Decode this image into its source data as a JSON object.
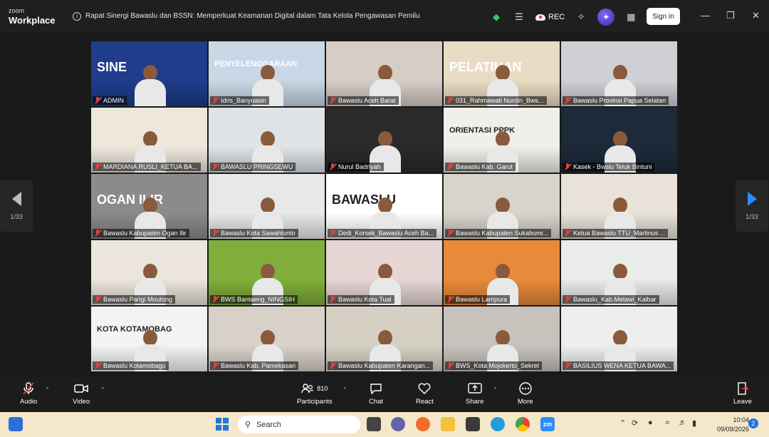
{
  "app": {
    "brand_top": "zoom",
    "brand_name": "Workplace"
  },
  "meeting": {
    "title": "Rapat Sinergi Bawaslu dan BSSN: Memperkuat Keamanan Digital dalam Tata Kelola Pengawasan Pemilu"
  },
  "titlebar": {
    "rec_label": "REC",
    "signin_label": "Sign in"
  },
  "pager": {
    "left_label": "1/33",
    "right_label": "1/33"
  },
  "participants": [
    {
      "name": "ADMIN",
      "bg": "#1f3d8a",
      "active": true,
      "overlay": "SINE"
    },
    {
      "name": "Idris_Banyuasin",
      "bg": "#c9d8e6",
      "overlay": "PENYELENGGARAAN"
    },
    {
      "name": "Bawaslu Aceh Barat",
      "bg": "#d6cdc6"
    },
    {
      "name": "031_Rahmawati Nurdin_Bws...",
      "bg": "#e9dcc4",
      "overlay": "PELATIHAN"
    },
    {
      "name": "Bawaslu Provinsi Papua Selatan",
      "bg": "#cfd0d6"
    },
    {
      "name": "MARDIANA RUSLI_KETUA BA...",
      "bg": "#eee7dc"
    },
    {
      "name": "BAWASLU PRINGSEWU",
      "bg": "#dfe3e6"
    },
    {
      "name": "Nurul Badriyah",
      "bg": "#2a2a2a"
    },
    {
      "name": "Bawaslu Kab. Garut",
      "bg": "#f1efe9",
      "overlay": "ORIENTASI PPPK"
    },
    {
      "name": "Kasek - Bwslu Teluk Bintuni",
      "bg": "#1d2a3a"
    },
    {
      "name": "Bawaslu Kabupaten Ogan Ilir",
      "bg": "#8b8b8b",
      "overlay": "OGAN ILIR"
    },
    {
      "name": "Bawaslu Kota Sawahlunto",
      "bg": "#e7e9e8"
    },
    {
      "name": "Dedi_Korsek_Bawaslu Aceh Ba...",
      "bg": "#ffffff",
      "overlay": "BAWASLU"
    },
    {
      "name": "Bawaslu Kabupaten Sukabumi...",
      "bg": "#d9d4cb"
    },
    {
      "name": "Ketua Bawaslu TTU_Martinus ...",
      "bg": "#e8e2d8"
    },
    {
      "name": "Bawaslu Parigi Moutong",
      "bg": "#ece5db"
    },
    {
      "name": "BWS Bantaeng_NINGSIH",
      "bg": "#7fae3a"
    },
    {
      "name": "Bawaslu Kota Tual",
      "bg": "#e6d6d4"
    },
    {
      "name": "Bawaslu Lampura",
      "bg": "#e78a3a"
    },
    {
      "name": "Bawaslu_Kab.Melawi_Kalbar",
      "bg": "#e9ece8"
    },
    {
      "name": "Bawaslu Kotamobagu",
      "bg": "#f3f3f3",
      "overlay": "KOTA KOTAMOBAG"
    },
    {
      "name": "Bawaslu Kab. Pamekasan",
      "bg": "#d8d1c8"
    },
    {
      "name": "Bawaslu Kabupaten Karangan...",
      "bg": "#d6d0c4"
    },
    {
      "name": "BWS_Kota Mojokerto_Sekret",
      "bg": "#c7c2bc"
    },
    {
      "name": "BASILIUS WENA KETUA BAWA...",
      "bg": "#eeeeee"
    }
  ],
  "toolbar": {
    "audio": "Audio",
    "video": "Video",
    "participants": "Participants",
    "participants_count": "810",
    "chat": "Chat",
    "react": "React",
    "share": "Share",
    "more": "More",
    "leave": "Leave"
  },
  "taskbar": {
    "search_placeholder": "Search",
    "time": "10:04",
    "date": "09/09/2026",
    "notifications": "2"
  },
  "colors": {
    "accent_green": "#2ecc71",
    "mic_off": "#e04040",
    "leave": "#e04040",
    "taskbar_bg": "#f5e7c9"
  }
}
